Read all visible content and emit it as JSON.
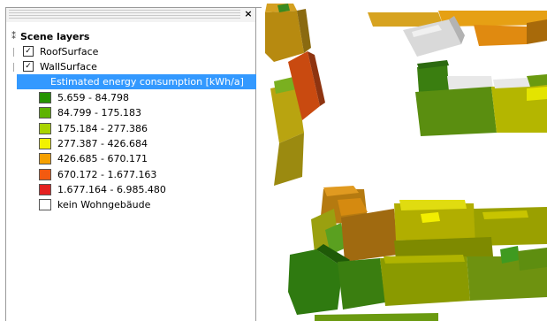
{
  "panel": {
    "close_label": "×",
    "tree": {
      "root": {
        "label": "Scene layers",
        "icon": "pin-icon"
      },
      "layers": [
        {
          "label": "RoofSurface",
          "checked": true
        },
        {
          "label": "WallSurface",
          "checked": true
        }
      ],
      "selected": {
        "label": "Estimated energy consumption [kWh/a]"
      }
    },
    "legend": [
      {
        "label": "5.659 - 84.798",
        "color": "#259400"
      },
      {
        "label": "84.799 - 175.183",
        "color": "#5db300"
      },
      {
        "label": "175.184 - 277.386",
        "color": "#a9d400"
      },
      {
        "label": "277.387 - 426.684",
        "color": "#f2f200"
      },
      {
        "label": "426.685 - 670.171",
        "color": "#f5a000"
      },
      {
        "label": "670.172 - 1.677.163",
        "color": "#f35a10"
      },
      {
        "label": "1.677.164 - 6.985.480",
        "color": "#e32020"
      },
      {
        "label": "kein Wohngebäude",
        "color": "#ffffff"
      }
    ]
  }
}
